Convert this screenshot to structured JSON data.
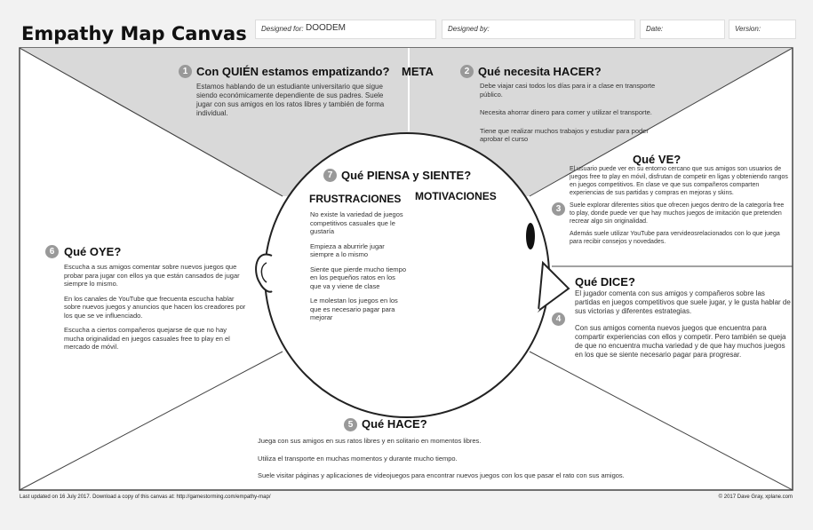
{
  "header": {
    "title": "Empathy Map Canvas",
    "designed_for_label": "Designed for:",
    "designed_for_value": "DOODEM",
    "designed_by_label": "Designed by:",
    "date_label": "Date:",
    "version_label": "Version:"
  },
  "who": {
    "number": "1",
    "title": "Con QUIÉN estamos empatizando?",
    "meta": "META",
    "text": "Estamos hablando de un estudiante universitario que sigue siendo económicamente dependiente de sus padres. Suele jugar con sus amigos en los ratos libres y también de forma individual."
  },
  "do": {
    "number": "2",
    "title": "Qué necesita HACER?",
    "items": [
      "Debe viajar casi todos los días para ir a clase en transporte público.",
      "Necesita ahorrar dinero para comer y utilizar el transporte.",
      "Tiene que realizar muchos trabajos y estudiar para poder aprobar el curso"
    ]
  },
  "see": {
    "number": "3",
    "title": "Qué VE?",
    "items": [
      "El usuario puede ver en su entorno cercano que sus amigos son usuarios de juegos free to play en móvil, disfrutan de competir en ligas y obteniendo rangos en juegos competitivos. En clase ve que sus compañeros comparten experiencias de sus partidas y compras en mejoras y skins.",
      "Suele explorar diferentes sitios que ofrecen juegos dentro de la categoría free to play, donde puede ver que hay muchos juegos de imitación que pretenden recrear algo sin originalidad.",
      "Además suele utilizar YouTube para vervideosrelacionados con lo que juega para recibir consejos y novedades."
    ]
  },
  "say": {
    "number": "4",
    "title": "Qué DICE?",
    "items": [
      "El jugador comenta con sus amigos y compañeros sobre las partidas en juegos competitivos que suele jugar, y le gusta hablar de sus victorias y diferentes estrategias.",
      "Con sus amigos comenta nuevos juegos que encuentra para compartir experiencias con ellos y competir. Pero también se queja de que no encuentra mucha variedad y de que hay muchos juegos en los que se siente necesario pagar para progresar."
    ]
  },
  "hace": {
    "number": "5",
    "title": "Qué HACE?",
    "items": [
      "Juega con sus amigos en sus ratos libres y en solitario en momentos libres.",
      "Utiliza el transporte en muchas momentos y durante mucho tiempo.",
      "Suele visitar páginas y aplicaciones de videojuegos para encontrar nuevos juegos con los que pasar el rato con sus amigos."
    ]
  },
  "hear": {
    "number": "6",
    "title": "Qué OYE?",
    "items": [
      "Escucha a sus amigos comentar sobre nuevos juegos que probar para jugar con ellos ya que están cansados de jugar siempre lo mismo.",
      "En los canales de YouTube que frecuenta escucha hablar sobre nuevos juegos y anuncios que hacen los creadores por los que se ve influenciado.",
      "Escucha a ciertos compañeros quejarse de que no hay mucha originalidad en juegos casuales free to play en el mercado de móvil."
    ]
  },
  "think": {
    "number": "7",
    "title": "Qué PIENSA y SIENTE?",
    "pains_title": "FRUSTRACIONES",
    "gains_title": "MOTIVACIONES",
    "pains": [
      "No existe la variedad de juegos competitivos casuales que le gustaría",
      "Empieza a aburrirle jugar siempre a lo mismo",
      "Siente que pierde mucho tiempo en los pequeños ratos en los que va y viene de clase",
      "Le molestan los juegos en los que es necesario pagar para mejorar"
    ]
  },
  "footer": {
    "left": "Last updated on 16 July 2017. Download a copy of this canvas at: http://gamestorming.com/empathy-map/",
    "right": "© 2017 Dave Gray, xplane.com"
  },
  "colors": {
    "shade": "#d9d9d9",
    "line": "#444444",
    "badge": "#999999"
  }
}
